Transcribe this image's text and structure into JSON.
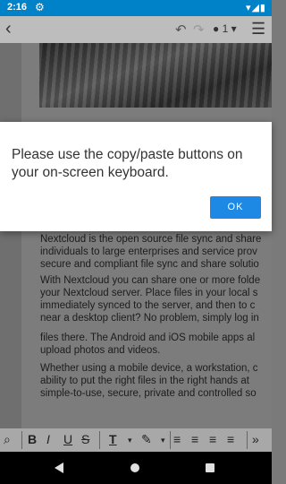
{
  "status_bar": {
    "time": "2:16",
    "settings_icon": "gear-icon",
    "system_icons": "▾◢▮"
  },
  "toolbar": {
    "user_count": "1"
  },
  "document": {
    "paragraphs": [
      "Nextcloud is the open source file sync and share",
      "individuals to large enterprises and service prov",
      "secure and compliant file sync and share solutio",
      "With Nextcloud you can share one or more folde",
      "your Nextcloud server. Place files in your local s",
      "immediately synced to the server, and then to c",
      "near a desktop client? No problem, simply log in",
      " files there. The Android and iOS mobile apps al",
      "upload photos and videos.",
      "Whether using a mobile device, a workstation, c",
      "ability to put the right files in the right hands at",
      "simple-to-use, secure, private and controlled so"
    ]
  },
  "dialog": {
    "message": "Please use the copy/paste buttons on your on-screen keyboard.",
    "ok_label": "OK"
  }
}
